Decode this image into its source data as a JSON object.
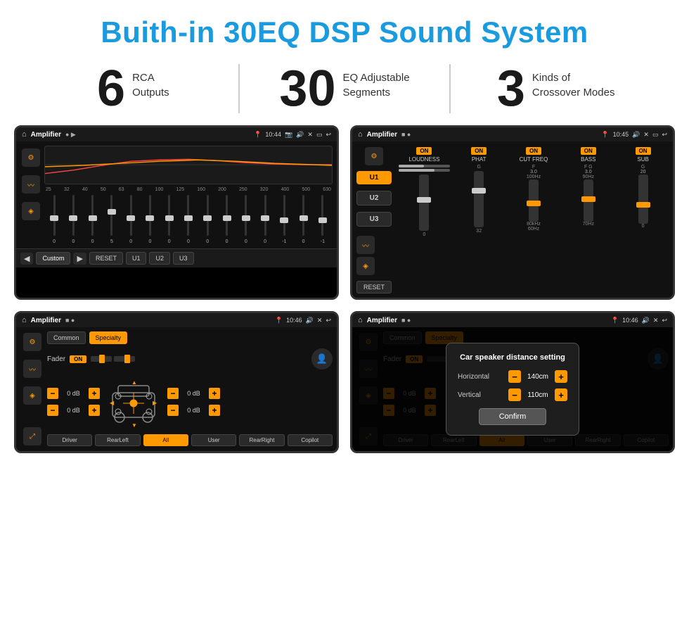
{
  "page": {
    "title": "Buith-in 30EQ DSP Sound System",
    "stats": [
      {
        "number": "6",
        "text": "RCA\nOutputs"
      },
      {
        "number": "30",
        "text": "EQ Adjustable\nSegments"
      },
      {
        "number": "3",
        "text": "Kinds of\nCrossover Modes"
      }
    ]
  },
  "screens": [
    {
      "id": "eq",
      "status": {
        "title": "Amplifier",
        "time": "10:44",
        "icons": "▶"
      },
      "eq_freqs": [
        "25",
        "32",
        "40",
        "50",
        "63",
        "80",
        "100",
        "125",
        "160",
        "200",
        "250",
        "320",
        "400",
        "500",
        "630"
      ],
      "eq_values": [
        "0",
        "0",
        "0",
        "5",
        "0",
        "0",
        "0",
        "0",
        "0",
        "0",
        "0",
        "0",
        "-1",
        "0",
        "-1"
      ],
      "preset": "Custom",
      "buttons": [
        "◀",
        "Custom",
        "▶",
        "RESET",
        "U1",
        "U2",
        "U3"
      ]
    },
    {
      "id": "crossover",
      "status": {
        "title": "Amplifier",
        "time": "10:45"
      },
      "u_buttons": [
        "U1",
        "U2",
        "U3"
      ],
      "controls": [
        "LOUDNESS",
        "PHAT",
        "CUT FREQ",
        "BASS",
        "SUB"
      ],
      "reset": "RESET"
    },
    {
      "id": "fader",
      "status": {
        "title": "Amplifier",
        "time": "10:46"
      },
      "tabs": [
        "Common",
        "Specialty"
      ],
      "fader_label": "Fader",
      "fader_on": "ON",
      "volumes": [
        "0 dB",
        "0 dB",
        "0 dB",
        "0 dB"
      ],
      "bottom_buttons": [
        "Driver",
        "RearLeft",
        "All",
        "User",
        "RearRight",
        "Copilot"
      ]
    },
    {
      "id": "dialog",
      "status": {
        "title": "Amplifier",
        "time": "10:46"
      },
      "tabs": [
        "Common",
        "Specialty"
      ],
      "dialog": {
        "title": "Car speaker distance setting",
        "rows": [
          {
            "label": "Horizontal",
            "value": "140cm"
          },
          {
            "label": "Vertical",
            "value": "110cm"
          }
        ],
        "confirm_label": "Confirm"
      },
      "bottom_buttons": [
        "Driver",
        "RearLeft",
        "All",
        "User",
        "RearRight",
        "Copilot"
      ]
    }
  ]
}
